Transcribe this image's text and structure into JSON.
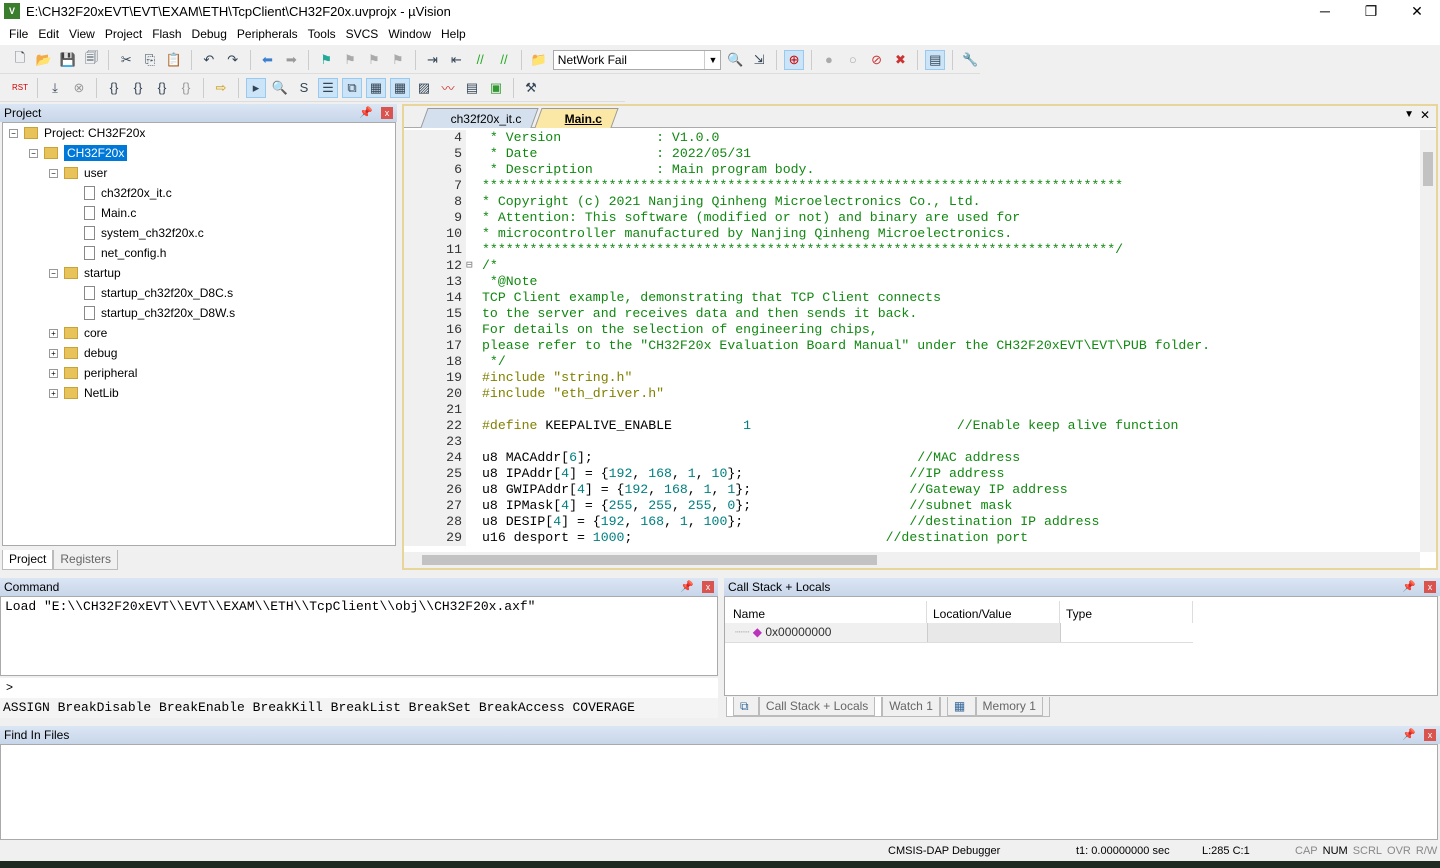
{
  "window": {
    "title": "E:\\CH32F20xEVT\\EVT\\EXAM\\ETH\\TcpClient\\CH32F20x.uvprojx - µVision",
    "minimize": "─",
    "maximize": "❐",
    "close": "✕"
  },
  "menu": [
    "File",
    "Edit",
    "View",
    "Project",
    "Flash",
    "Debug",
    "Peripherals",
    "Tools",
    "SVCS",
    "Window",
    "Help"
  ],
  "toolbar": {
    "target_combo": "NetWork Fail"
  },
  "project": {
    "title": "Project",
    "tree": [
      {
        "label": "Project: CH32F20x",
        "level": 0,
        "type": "project",
        "exp": "−"
      },
      {
        "label": "CH32F20x",
        "level": 1,
        "type": "folder",
        "exp": "−",
        "selected": true
      },
      {
        "label": "user",
        "level": 2,
        "type": "folder",
        "exp": "−"
      },
      {
        "label": "ch32f20x_it.c",
        "level": 3,
        "type": "file"
      },
      {
        "label": "Main.c",
        "level": 3,
        "type": "file"
      },
      {
        "label": "system_ch32f20x.c",
        "level": 3,
        "type": "file"
      },
      {
        "label": "net_config.h",
        "level": 3,
        "type": "file"
      },
      {
        "label": "startup",
        "level": 2,
        "type": "folder",
        "exp": "−"
      },
      {
        "label": "startup_ch32f20x_D8C.s",
        "level": 3,
        "type": "file"
      },
      {
        "label": "startup_ch32f20x_D8W.s",
        "level": 3,
        "type": "file"
      },
      {
        "label": "core",
        "level": 2,
        "type": "folder",
        "exp": "+"
      },
      {
        "label": "debug",
        "level": 2,
        "type": "folder",
        "exp": "+"
      },
      {
        "label": "peripheral",
        "level": 2,
        "type": "folder",
        "exp": "+"
      },
      {
        "label": "NetLib",
        "level": 2,
        "type": "folder",
        "exp": "+"
      }
    ],
    "tabs": [
      "Project",
      "Registers"
    ]
  },
  "editor": {
    "tabs": [
      "ch32f20x_it.c",
      "Main.c"
    ],
    "active_tab": "Main.c",
    "lines": [
      {
        "no": "4",
        "seg": [
          [
            " * Version            : V1.0.0",
            "c"
          ]
        ]
      },
      {
        "no": "5",
        "seg": [
          [
            " * Date               : 2022/05/31",
            "c"
          ]
        ]
      },
      {
        "no": "6",
        "seg": [
          [
            " * Description        : Main program body.",
            "c"
          ]
        ]
      },
      {
        "no": "7",
        "seg": [
          [
            "*********************************************************************************",
            "c"
          ]
        ]
      },
      {
        "no": "8",
        "seg": [
          [
            "* Copyright (c) 2021 Nanjing Qinheng Microelectronics Co., Ltd.",
            "c"
          ]
        ]
      },
      {
        "no": "9",
        "seg": [
          [
            "* Attention: This software (modified or not) and binary are used for",
            "c"
          ]
        ]
      },
      {
        "no": "10",
        "seg": [
          [
            "* microcontroller manufactured by Nanjing Qinheng Microelectronics.",
            "c"
          ]
        ]
      },
      {
        "no": "11",
        "seg": [
          [
            "********************************************************************************/",
            "c"
          ]
        ]
      },
      {
        "no": "12",
        "seg": [
          [
            "/*",
            "c"
          ]
        ]
      },
      {
        "no": "13",
        "seg": [
          [
            " *@Note",
            "c"
          ]
        ]
      },
      {
        "no": "14",
        "seg": [
          [
            "TCP Client example, demonstrating that TCP Client connects",
            "c"
          ]
        ]
      },
      {
        "no": "15",
        "seg": [
          [
            "to the server and receives data and then sends it back.",
            "c"
          ]
        ]
      },
      {
        "no": "16",
        "seg": [
          [
            "For details on the selection of engineering chips,",
            "c"
          ]
        ]
      },
      {
        "no": "17",
        "seg": [
          [
            "please refer to the \"CH32F20x Evaluation Board Manual\" under the CH32F20xEVT\\EVT\\PUB folder.",
            "c"
          ]
        ]
      },
      {
        "no": "18",
        "seg": [
          [
            " */",
            "c"
          ]
        ]
      },
      {
        "no": "19",
        "seg": [
          [
            "#include ",
            "p"
          ],
          [
            "\"string.h\"",
            "s"
          ]
        ]
      },
      {
        "no": "20",
        "seg": [
          [
            "#include ",
            "p"
          ],
          [
            "\"eth_driver.h\"",
            "s"
          ]
        ]
      },
      {
        "no": "21",
        "seg": []
      },
      {
        "no": "22",
        "seg": [
          [
            "#define ",
            "p"
          ],
          [
            "KEEPALIVE_ENABLE         ",
            "k"
          ],
          [
            "1",
            "n"
          ],
          [
            "                          ",
            "k"
          ],
          [
            "//Enable keep alive function",
            "c"
          ]
        ]
      },
      {
        "no": "23",
        "seg": []
      },
      {
        "no": "24",
        "seg": [
          [
            "u8 MACAddr[",
            "k"
          ],
          [
            "6",
            "n"
          ],
          [
            "];                                         ",
            "k"
          ],
          [
            "//MAC address",
            "c"
          ]
        ]
      },
      {
        "no": "25",
        "seg": [
          [
            "u8 IPAddr[",
            "k"
          ],
          [
            "4",
            "n"
          ],
          [
            "] = {",
            "k"
          ],
          [
            "192",
            "n"
          ],
          [
            ", ",
            "k"
          ],
          [
            "168",
            "n"
          ],
          [
            ", ",
            "k"
          ],
          [
            "1",
            "n"
          ],
          [
            ", ",
            "k"
          ],
          [
            "10",
            "n"
          ],
          [
            "};                     ",
            "k"
          ],
          [
            "//IP address",
            "c"
          ]
        ]
      },
      {
        "no": "26",
        "seg": [
          [
            "u8 GWIPAddr[",
            "k"
          ],
          [
            "4",
            "n"
          ],
          [
            "] = {",
            "k"
          ],
          [
            "192",
            "n"
          ],
          [
            ", ",
            "k"
          ],
          [
            "168",
            "n"
          ],
          [
            ", ",
            "k"
          ],
          [
            "1",
            "n"
          ],
          [
            ", ",
            "k"
          ],
          [
            "1",
            "n"
          ],
          [
            "};                    ",
            "k"
          ],
          [
            "//Gateway IP address",
            "c"
          ]
        ]
      },
      {
        "no": "27",
        "seg": [
          [
            "u8 IPMask[",
            "k"
          ],
          [
            "4",
            "n"
          ],
          [
            "] = {",
            "k"
          ],
          [
            "255",
            "n"
          ],
          [
            ", ",
            "k"
          ],
          [
            "255",
            "n"
          ],
          [
            ", ",
            "k"
          ],
          [
            "255",
            "n"
          ],
          [
            ", ",
            "k"
          ],
          [
            "0",
            "n"
          ],
          [
            "};                    ",
            "k"
          ],
          [
            "//subnet mask",
            "c"
          ]
        ]
      },
      {
        "no": "28",
        "seg": [
          [
            "u8 DESIP[",
            "k"
          ],
          [
            "4",
            "n"
          ],
          [
            "] = {",
            "k"
          ],
          [
            "192",
            "n"
          ],
          [
            ", ",
            "k"
          ],
          [
            "168",
            "n"
          ],
          [
            ", ",
            "k"
          ],
          [
            "1",
            "n"
          ],
          [
            ", ",
            "k"
          ],
          [
            "100",
            "n"
          ],
          [
            "};                     ",
            "k"
          ],
          [
            "//destination IP address",
            "c"
          ]
        ]
      },
      {
        "no": "29",
        "seg": [
          [
            "u16 desport = ",
            "k"
          ],
          [
            "1000",
            "n"
          ],
          [
            ";                                ",
            "k"
          ],
          [
            "//destination port",
            "c"
          ]
        ]
      }
    ]
  },
  "command": {
    "title": "Command",
    "output": "Load \"E:\\\\CH32F20xEVT\\\\EVT\\\\EXAM\\\\ETH\\\\TcpClient\\\\obj\\\\CH32F20x.axf\"",
    "prompt": ">",
    "hint": "ASSIGN BreakDisable BreakEnable BreakKill BreakList BreakSet BreakAccess COVERAGE"
  },
  "callstack": {
    "title": "Call Stack + Locals",
    "columns": [
      "Name",
      "Location/Value",
      "Type"
    ],
    "rows": [
      {
        "name": "0x00000000",
        "value": "",
        "type": ""
      }
    ],
    "tabs": [
      "Call Stack + Locals",
      "Watch 1",
      "Memory 1"
    ]
  },
  "find": {
    "title": "Find In Files"
  },
  "status": {
    "debugger": "CMSIS-DAP Debugger",
    "time": "t1: 0.00000000 sec",
    "position": "L:285 C:1",
    "flags": [
      "CAP",
      "NUM",
      "SCRL",
      "OVR",
      "R/W"
    ]
  }
}
